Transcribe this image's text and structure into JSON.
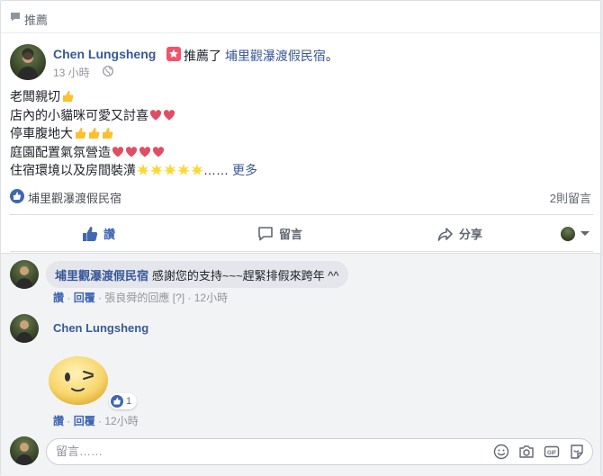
{
  "section_label": "推薦",
  "post": {
    "author": "Chen Lungsheng",
    "action_text": "推薦了",
    "page_name": "埔里觀瀑渡假民宿",
    "suffix": "。",
    "time": "13 小時",
    "lines": [
      "老闆親切",
      "店內的小貓咪可愛又討喜",
      "停車腹地大",
      "庭園配置氣氛營造",
      "住宿環境以及房間裝潢"
    ],
    "ellipsis": "……",
    "more": "更多",
    "tagged_page": "埔里觀瀑渡假民宿",
    "comment_count": "2則留言"
  },
  "actions": {
    "like": "讚",
    "comment": "留言",
    "share": "分享"
  },
  "comments": [
    {
      "name": "埔里觀瀑渡假民宿",
      "text": "感謝您的支持~~~趕緊排假來跨年 ^^",
      "like": "讚",
      "reply": "回覆",
      "replied_by": "張良舜的回應",
      "edited": "[?]",
      "time": "12小時"
    },
    {
      "name": "Chen Lungsheng",
      "sticker": "wink-emoji-sticker",
      "reactions": "1",
      "like": "讚",
      "reply": "回覆",
      "time": "12小時"
    }
  ],
  "composer": {
    "placeholder": "留言……"
  },
  "colors": {
    "link": "#385898",
    "accent": "#4267b2",
    "badge": "#f35369"
  }
}
